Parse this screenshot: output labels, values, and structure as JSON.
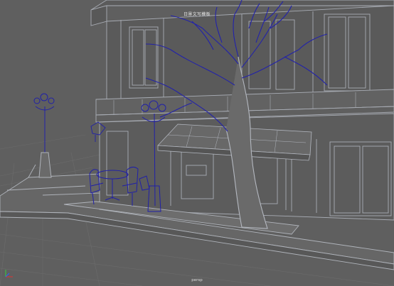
{
  "viewport": {
    "panel_title": "日景文写模板",
    "camera_name": "persp",
    "colors": {
      "background": "#5f5f5f",
      "grid": "#6a6a6a",
      "wire_gray": "#a8acb4",
      "wire_selected": "#1e1ea8",
      "axis_x": "#e23030",
      "axis_y": "#30d040",
      "axis_z": "#3060ff"
    },
    "objects": [
      {
        "name": "building",
        "icon": "building-mesh"
      },
      {
        "name": "tree",
        "icon": "tree-mesh",
        "selected": true
      },
      {
        "name": "street-lamp-left",
        "icon": "lamp-mesh",
        "selected": true
      },
      {
        "name": "street-lamp-center",
        "icon": "lamp-mesh",
        "selected": true
      },
      {
        "name": "cafe-table",
        "icon": "table-mesh",
        "selected": true
      },
      {
        "name": "cafe-chairs",
        "icon": "chair-mesh",
        "selected": true
      },
      {
        "name": "awning",
        "icon": "awning-mesh"
      },
      {
        "name": "sidewalk",
        "icon": "sidewalk-mesh"
      }
    ]
  }
}
